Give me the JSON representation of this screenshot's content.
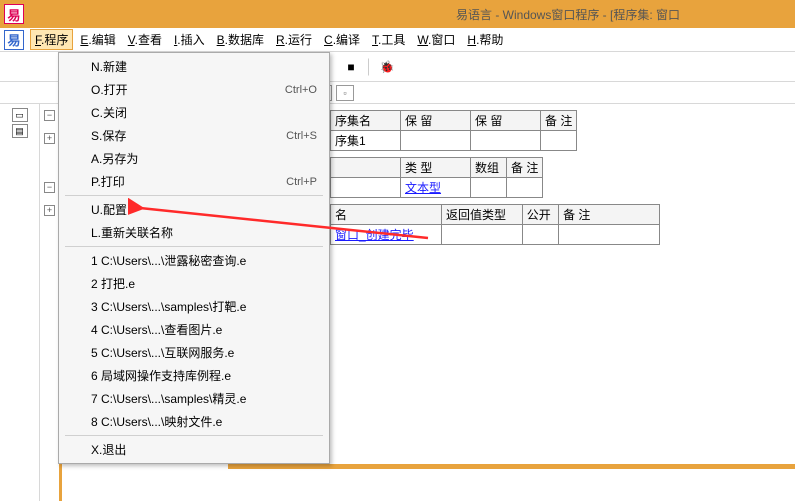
{
  "window": {
    "title": "易语言 - Windows窗口程序 - [程序集: 窗口"
  },
  "menubar": [
    {
      "key": "F",
      "label": "程序"
    },
    {
      "key": "E",
      "label": "编辑"
    },
    {
      "key": "V",
      "label": "查看"
    },
    {
      "key": "I",
      "label": "插入"
    },
    {
      "key": "B",
      "label": "数据库"
    },
    {
      "key": "R",
      "label": "运行"
    },
    {
      "key": "C",
      "label": "编译"
    },
    {
      "key": "T",
      "label": "工具"
    },
    {
      "key": "W",
      "label": "窗口"
    },
    {
      "key": "H",
      "label": "帮助"
    }
  ],
  "file_menu": {
    "items": [
      {
        "label": "N.新建",
        "shortcut": ""
      },
      {
        "label": "O.打开",
        "shortcut": "Ctrl+O"
      },
      {
        "label": "C.关闭",
        "shortcut": ""
      },
      {
        "label": "S.保存",
        "shortcut": "Ctrl+S"
      },
      {
        "label": "A.另存为",
        "shortcut": ""
      },
      {
        "label": "P.打印",
        "shortcut": "Ctrl+P"
      }
    ],
    "config_items": [
      {
        "label": "U.配置",
        "shortcut": ""
      },
      {
        "label": "L.重新关联名称",
        "shortcut": ""
      }
    ],
    "recent": [
      "1 C:\\Users\\...\\泄露秘密查询.e",
      "2 打把.e",
      "3 C:\\Users\\...\\samples\\打靶.e",
      "4 C:\\Users\\...\\查看图片.e",
      "5 C:\\Users\\...\\互联网服务.e",
      "6 局域网操作支持库例程.e",
      "7 C:\\Users\\...\\samples\\精灵.e",
      "8 C:\\Users\\...\\映射文件.e"
    ],
    "exit": "X.退出"
  },
  "tables": {
    "t1": {
      "headers": [
        "序集名",
        "保  留",
        "保  留",
        "备  注"
      ],
      "row": [
        "序集1",
        "",
        "",
        ""
      ]
    },
    "t2": {
      "headers": [
        "",
        "类  型",
        "数组",
        "备  注"
      ],
      "row": [
        "",
        "文本型",
        "",
        ""
      ]
    },
    "t3": {
      "headers": [
        "名",
        "返回值类型",
        "公开",
        "备  注"
      ],
      "row": [
        "窗口_创建完毕",
        "",
        "",
        ""
      ]
    }
  },
  "toolbar_icons": [
    "play-icon",
    "stop-icon",
    "debug-icon"
  ],
  "secondary_icons": [
    "maximize-icon",
    "restore-icon"
  ]
}
